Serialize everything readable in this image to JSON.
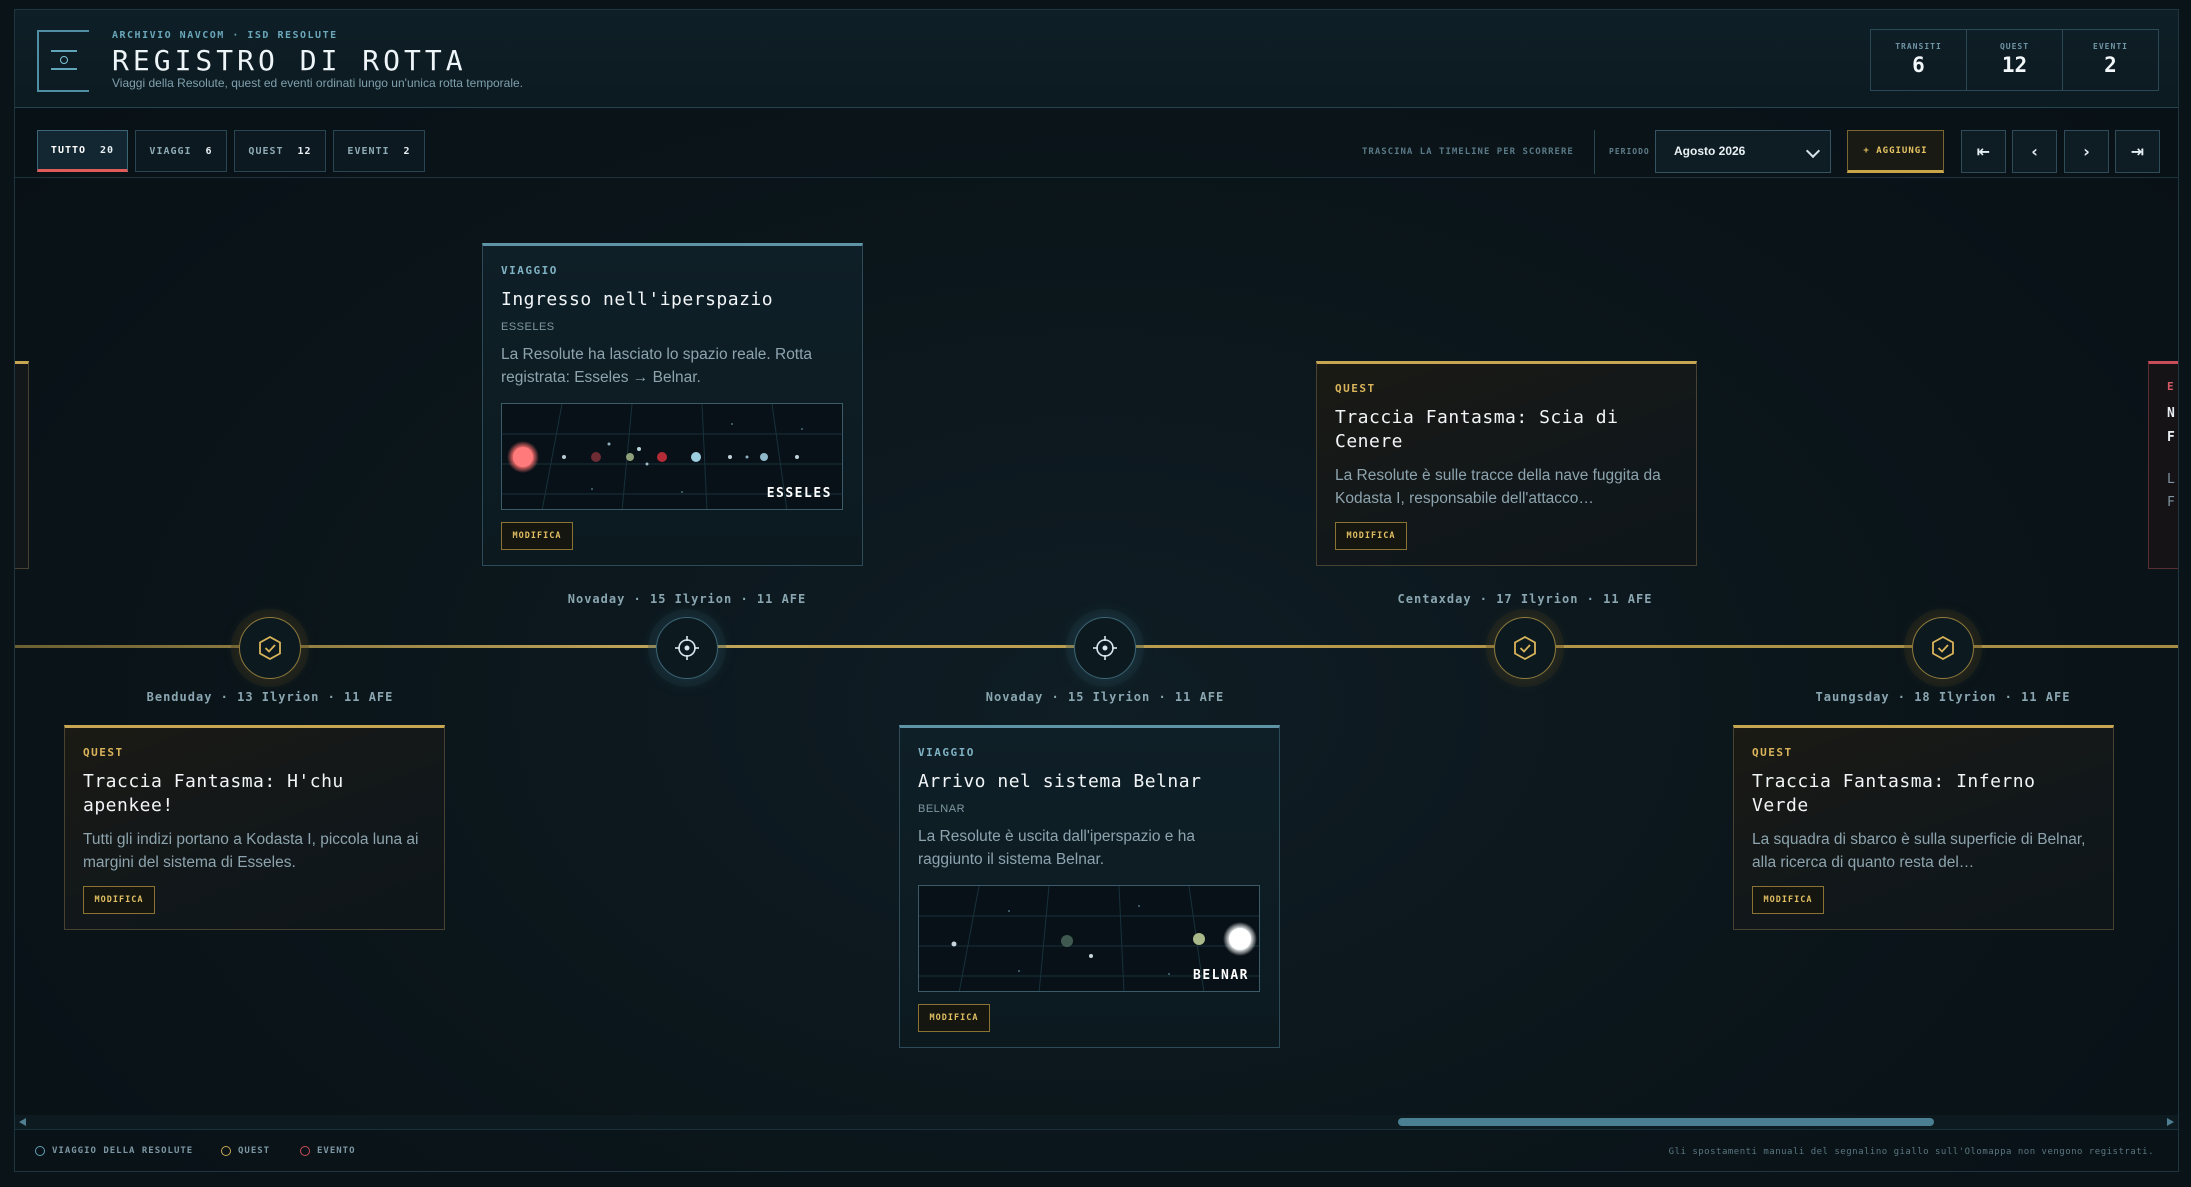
{
  "header": {
    "kicker": "ARCHIVIO NAVCOM · ISD RESOLUTE",
    "title": "REGISTRO DI ROTTA",
    "subtitle": "Viaggi della Resolute, quest ed eventi ordinati lungo un'unica rotta temporale.",
    "stats": [
      {
        "label": "TRANSITI",
        "value": "6"
      },
      {
        "label": "QUEST",
        "value": "12"
      },
      {
        "label": "EVENTI",
        "value": "2"
      }
    ]
  },
  "toolbar": {
    "filters": [
      {
        "label": "TUTTO",
        "count": "20"
      },
      {
        "label": "VIAGGI",
        "count": "6"
      },
      {
        "label": "QUEST",
        "count": "12"
      },
      {
        "label": "EVENTI",
        "count": "2"
      }
    ],
    "hint": "TRASCINA LA TIMELINE PER SCORRERE",
    "period_label": "PERIODO",
    "period_value": "Agosto 2026",
    "add_label": "+ AGGIUNGI",
    "nav": {
      "first": "⇤",
      "prev": "‹",
      "next": "›",
      "last": "⇥"
    }
  },
  "timeline": {
    "dates": [
      "Benduday · 13 Ilyrion · 11 AFE",
      "Novaday · 15 Ilyrion · 11 AFE",
      "Novaday · 15 Ilyrion · 11 AFE",
      "Centaxday · 17 Ilyrion · 11 AFE",
      "Taungsday · 18 Ilyrion · 11 AFE"
    ],
    "cards": [
      {
        "kind": "VIAGGIO",
        "title": "Ingresso nell'iperspazio",
        "place": "ESSELES",
        "desc": "La Resolute ha lasciato lo spazio reale. Rotta registrata: Esseles → Belnar.",
        "map_label": "ESSELES",
        "edit": "MODIFICA"
      },
      {
        "kind": "QUEST",
        "title": "Traccia Fantasma: Scia di Cenere",
        "desc": "La Resolute è sulle tracce della nave fuggita da Kodasta I, responsabile dell'attacco…",
        "edit": "MODIFICA"
      },
      {
        "kind": "QUEST",
        "title": "Traccia Fantasma: H'chu apenkee!",
        "desc": "Tutti gli indizi portano a Kodasta I, piccola luna ai margini del sistema di Esseles.",
        "edit": "MODIFICA"
      },
      {
        "kind": "VIAGGIO",
        "title": "Arrivo nel sistema Belnar",
        "place": "BELNAR",
        "desc": "La Resolute è uscita dall'iperspazio e ha raggiunto il sistema Belnar.",
        "map_label": "BELNAR",
        "edit": "MODIFICA"
      },
      {
        "kind": "QUEST",
        "title": "Traccia Fantasma: Inferno Verde",
        "desc": "La squadra di sbarco è sulla superficie di Belnar, alla ricerca di quanto resta del…",
        "edit": "MODIFICA"
      }
    ],
    "edge_right_fragments": [
      "E",
      "N",
      "F",
      "L",
      "F"
    ]
  },
  "legend": [
    {
      "label": "VIAGGIO DELLA RESOLUTE",
      "color": "#5f9fb3"
    },
    {
      "label": "QUEST",
      "color": "#c6a652"
    },
    {
      "label": "EVENTO",
      "color": "#c94d58"
    }
  ],
  "footer_note": "Gli spostamenti manuali del segnalino giallo sull'Olomappa non vengono registrati.",
  "colors": {
    "accent_gold": "#c6a652",
    "accent_blue": "#5f93a6",
    "accent_red": "#e05a5a"
  }
}
